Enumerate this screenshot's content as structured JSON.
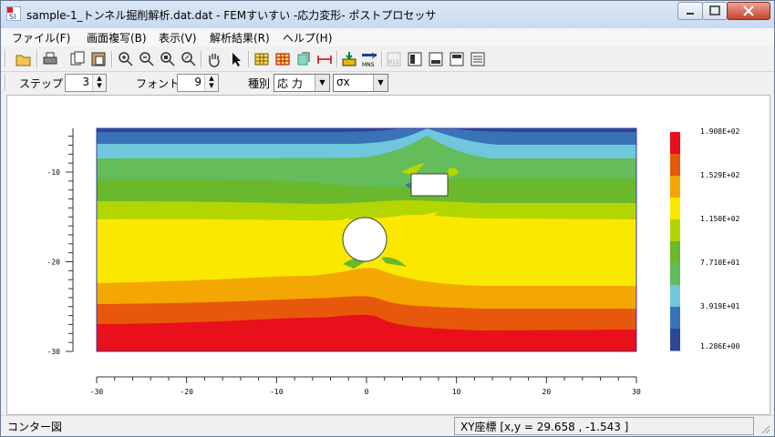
{
  "window": {
    "title": "sample-1_トンネル掘削解析.dat.dat - FEMすいすい -応力変形- ポストプロセッサ",
    "app_icon": "fem-app-icon"
  },
  "menu": [
    "ファイル(F)",
    "画面複写(B)",
    "表示(V)",
    "解析結果(R)",
    "ヘルプ(H)"
  ],
  "toolbar": {
    "icons": [
      "open-folder-icon",
      "print-icon",
      "copy-icon",
      "paste-icon",
      "zoom-in-icon",
      "zoom-out-icon",
      "zoom-fit-icon",
      "zoom-window-icon",
      "pan-hand-icon",
      "pointer-icon",
      "mesh-icon",
      "mesh-color-icon",
      "copy-view-icon",
      "dimension-icon",
      "export-icon",
      "mns-icon",
      "b12-icon",
      "panel-1-icon",
      "panel-2-icon",
      "panel-3-icon",
      "list-icon"
    ],
    "mns_label": "MNS"
  },
  "options": {
    "step_label": "ステップ",
    "step_value": "3",
    "font_label": "フォント",
    "font_value": "9",
    "type_label": "種別",
    "type_value": "応 力",
    "component_value": "σx"
  },
  "plot": {
    "x_ticks": [
      "-30",
      "-20",
      "-10",
      "0",
      "10",
      "20",
      "30"
    ],
    "y_ticks": [
      "-10",
      "-20",
      "-30"
    ],
    "legend_labels": [
      "1.908E+02",
      "1.529E+02",
      "1.150E+02",
      "7.710E+01",
      "3.919E+01",
      "1.286E+00"
    ],
    "colors": [
      "#e8101a",
      "#e8580c",
      "#f4a602",
      "#fbe800",
      "#b3d600",
      "#6ab82c",
      "#64bc5a",
      "#70c6dc",
      "#3a72b8",
      "#2e4696"
    ]
  },
  "status": {
    "left": "コンター図",
    "right": "XY座標 [x,y  =  29.658 , -1.543 ]"
  }
}
